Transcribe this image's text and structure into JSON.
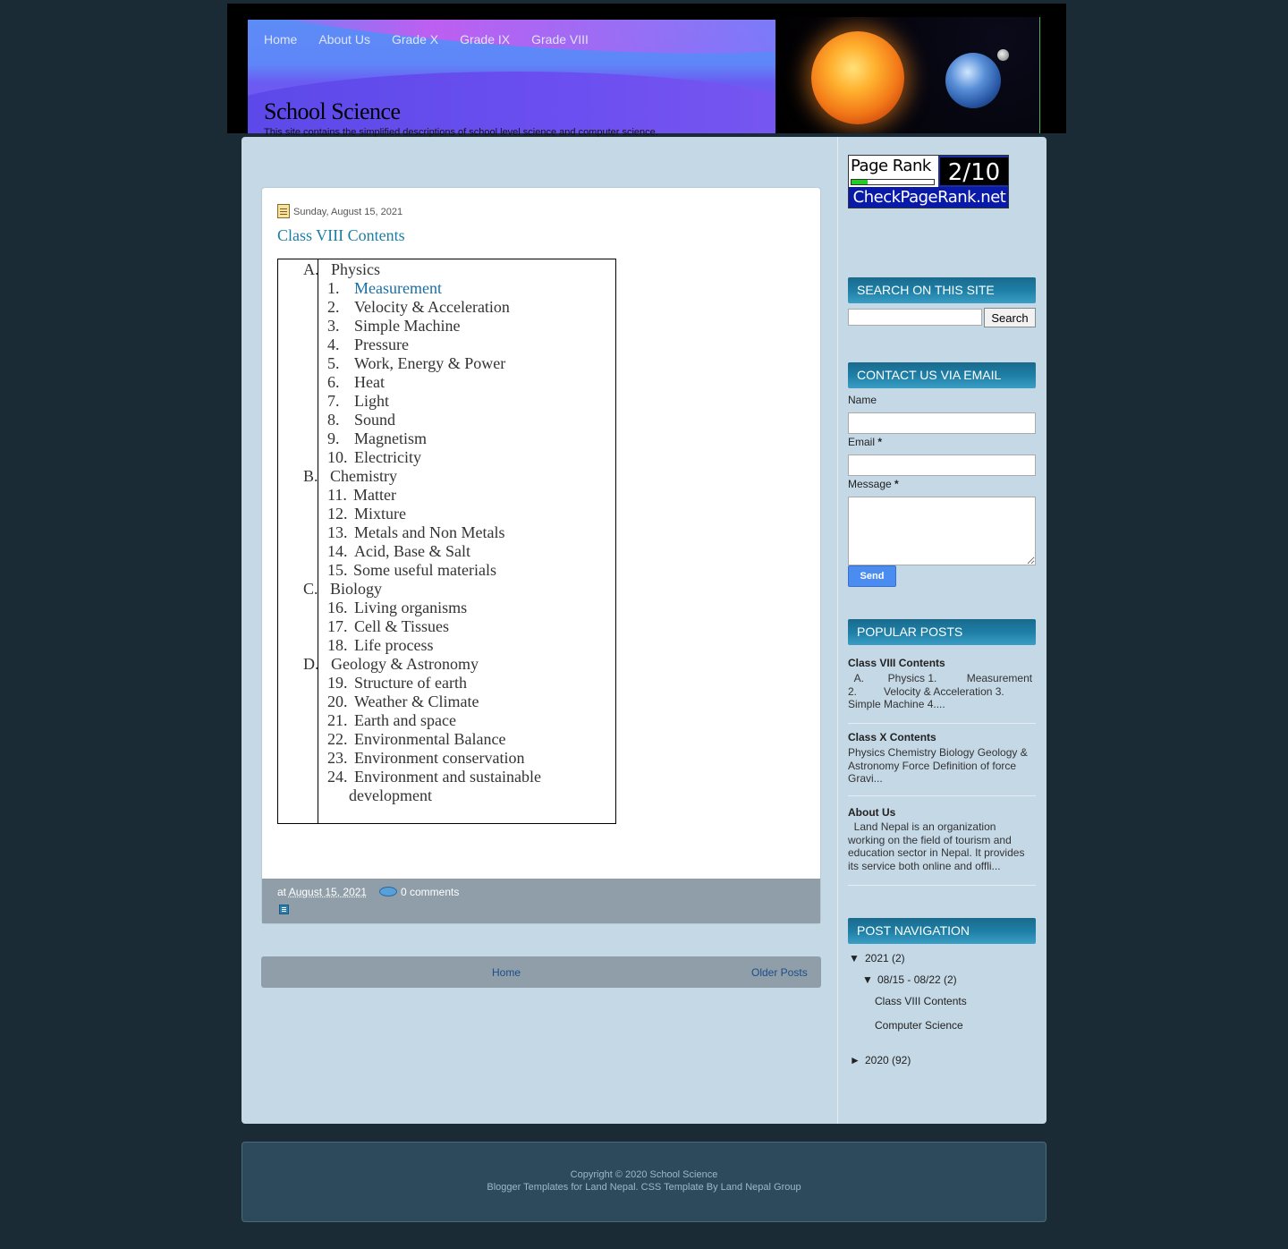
{
  "nav": [
    "Home",
    "About Us",
    "Grade X",
    "Grade IX",
    "Grade VIII"
  ],
  "site": {
    "title": "School Science",
    "description": "This site contains the simplified descriptions of school level science and computer science."
  },
  "post": {
    "date": "Sunday, August 15, 2021",
    "title": "Class VIII Contents",
    "sections": [
      {
        "letter": "A.",
        "name": "Physics"
      },
      {
        "letter": "B.",
        "name": "Chemistry"
      },
      {
        "letter": "C.",
        "name": "Biology"
      },
      {
        "letter": "D.",
        "name": "Geology & Astronomy"
      }
    ],
    "items": [
      {
        "num": "1.",
        "label": "Measurement"
      },
      {
        "num": "2.",
        "label": "Velocity & Acceleration"
      },
      {
        "num": "3.",
        "label": "Simple Machine"
      },
      {
        "num": "4.",
        "label": "Pressure"
      },
      {
        "num": "5.",
        "label": "Work, Energy & Power"
      },
      {
        "num": "6.",
        "label": "Heat"
      },
      {
        "num": "7.",
        "label": "Light"
      },
      {
        "num": "8.",
        "label": "Sound"
      },
      {
        "num": "9.",
        "label": "Magnetism"
      },
      {
        "num": "10.",
        "label": "Electricity"
      },
      {
        "num": "11.",
        "label": "Matter"
      },
      {
        "num": "12.",
        "label": "Mixture"
      },
      {
        "num": "13.",
        "label": "Metals and Non Metals"
      },
      {
        "num": "14.",
        "label": "Acid, Base & Salt"
      },
      {
        "num": "15.",
        "label": "Some useful materials"
      },
      {
        "num": "16.",
        "label": "Living organisms"
      },
      {
        "num": "17.",
        "label": "Cell & Tissues"
      },
      {
        "num": "18.",
        "label": "Life process"
      },
      {
        "num": "19.",
        "label": "Structure of earth"
      },
      {
        "num": "20.",
        "label": "Weather & Climate"
      },
      {
        "num": "21.",
        "label": "Earth and space"
      },
      {
        "num": "22.",
        "label": "Environmental Balance"
      },
      {
        "num": "23.",
        "label": "Environment conservation"
      },
      {
        "num": "24.",
        "label": "Environment and sustainable"
      },
      {
        "num": "",
        "label": "development"
      }
    ],
    "footer": {
      "at": "at",
      "date_link": "August 15, 2021",
      "comments": "0 comments"
    }
  },
  "pager": {
    "home": "Home",
    "older": "Older Posts"
  },
  "sidebar": {
    "pagerank": {
      "label": "Page Rank",
      "score": "2/10",
      "site": "CheckPageRank.net",
      "level": 0.2
    },
    "search": {
      "title": "Search On This Site",
      "button": "Search"
    },
    "contact": {
      "title": "Contact Us Via Email",
      "name_label": "Name",
      "email_label": "Email",
      "message_label": "Message",
      "required_mark": "*",
      "send": "Send"
    },
    "popular": {
      "title": "Popular Posts",
      "posts": [
        {
          "title": "Class VIII Contents",
          "snippet": "  A.        Physics 1.          Measurement 2.         Velocity & Acceleration 3.         Simple Machine 4...."
        },
        {
          "title": "Class X Contents",
          "snippet": "Physics Chemistry Biology Geology & Astronomy Force Definition of force Gravi..."
        },
        {
          "title": "About Us",
          "snippet": "  Land Nepal is an organization working on the field of tourism and education sector in Nepal. It provides its service both online and offli..."
        }
      ]
    },
    "navigation": {
      "title": "Post Navigation",
      "year_2021": {
        "arrow": "▼",
        "label": "2021",
        "count": "(2)"
      },
      "week": {
        "arrow": "▼",
        "label": "08/15 - 08/22",
        "count": "(2)"
      },
      "posts": [
        "Class VIII Contents",
        "Computer Science"
      ],
      "year_2020": {
        "arrow": "►",
        "label": "2020",
        "count": "(92)"
      }
    }
  },
  "footer": {
    "copyright": "Copyright © 2020 School Science",
    "credit": "Blogger Templates for Land Nepal. CSS Template By Land Nepal Group"
  }
}
